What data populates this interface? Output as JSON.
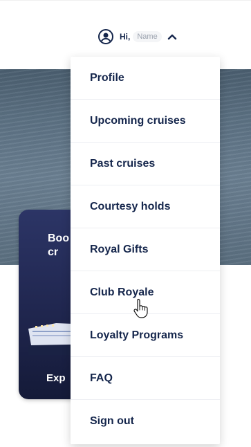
{
  "header": {
    "greeting": "Hi,",
    "name": "Name",
    "icons": {
      "avatar": "user-circle-icon",
      "toggle": "chevron-up-icon"
    }
  },
  "promo": {
    "title": "Boo\ncr",
    "cta": "Exp"
  },
  "menu": {
    "items": [
      {
        "label": "Profile"
      },
      {
        "label": "Upcoming cruises"
      },
      {
        "label": "Past cruises"
      },
      {
        "label": "Courtesy holds"
      },
      {
        "label": "Royal Gifts"
      },
      {
        "label": "Club Royale"
      },
      {
        "label": "Loyalty Programs"
      },
      {
        "label": "FAQ"
      },
      {
        "label": "Sign out"
      }
    ]
  },
  "colors": {
    "text": "#15264c",
    "divider": "#eceef2",
    "card": "#232a55"
  }
}
